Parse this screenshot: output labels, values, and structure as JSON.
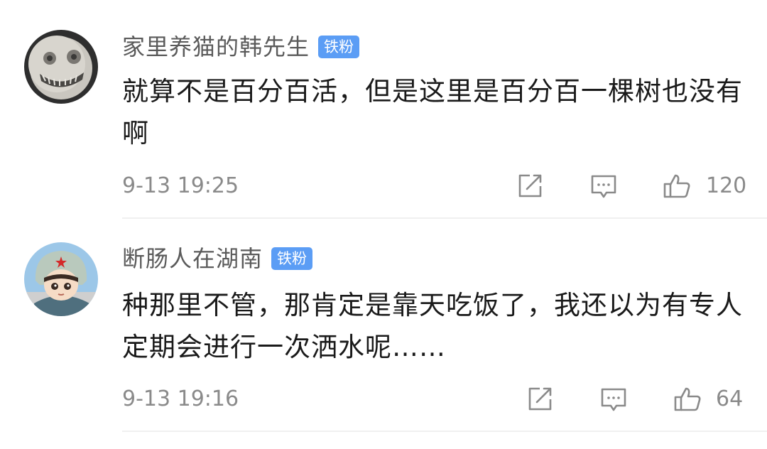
{
  "comments": [
    {
      "username": "家里养猫的韩先生",
      "badge": "铁粉",
      "text": "就算不是百分百活，但是这里是百分百一棵树也没有啊",
      "time": "9-13 19:25",
      "likes": "120",
      "avatar_icon": "grinning-moon-face-avatar"
    },
    {
      "username": "断肠人在湖南",
      "badge": "铁粉",
      "text": "种那里不管，那肯定是靠天吃饭了，我还以为有专人定期会进行一次洒水呢……",
      "time": "9-13 19:16",
      "likes": "64",
      "avatar_icon": "cartoon-pilot-avatar"
    }
  ],
  "icons": {
    "share": "share-icon",
    "reply": "comment-icon",
    "like": "thumbs-up-icon"
  },
  "colors": {
    "badge": "#5b9df5",
    "meta_text": "#8a8a8a",
    "username": "#5a5a5a",
    "body_text": "#1a1a1a"
  }
}
